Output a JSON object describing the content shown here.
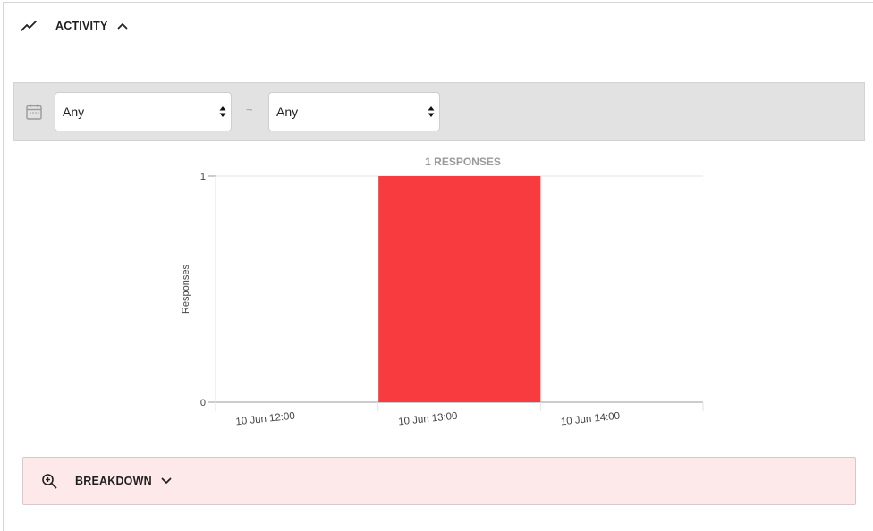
{
  "activity": {
    "title": "ACTIVITY",
    "trend_icon": "trending-up-icon",
    "toggle_icon": "chevron-up-icon"
  },
  "filter": {
    "calendar_icon": "calendar-icon",
    "from_value": "Any",
    "separator": "~",
    "to_value": "Any"
  },
  "chart_data": {
    "type": "bar",
    "title": "1 RESPONSES",
    "ylabel": "Responses",
    "xlabel": "",
    "categories": [
      "10 Jun 12:00",
      "10 Jun 13:00",
      "10 Jun 14:00"
    ],
    "values": [
      0,
      1,
      0
    ],
    "ylim": [
      0,
      1
    ],
    "yticks": [
      "0",
      "1"
    ],
    "bar_color": "#f73b3e",
    "grid": true
  },
  "breakdown": {
    "title": "BREAKDOWN",
    "zoom_icon": "zoom-in-icon",
    "toggle_icon": "chevron-down-icon"
  }
}
